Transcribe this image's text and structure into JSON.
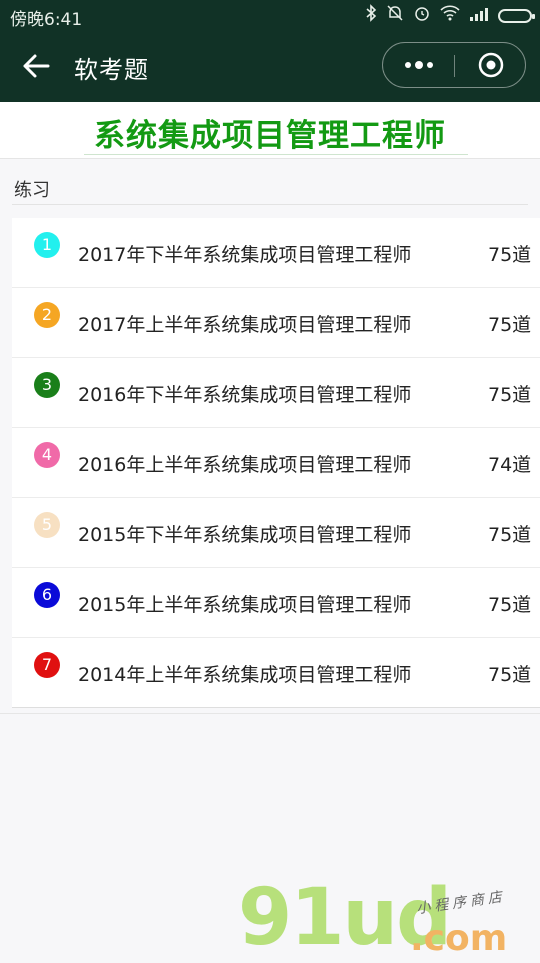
{
  "status_bar": {
    "time": "傍晚6:41",
    "icons": [
      "bluetooth-icon",
      "mute-icon",
      "alarm-icon",
      "wifi-icon",
      "signal-icon",
      "battery-icon"
    ]
  },
  "nav": {
    "title": "软考题",
    "back_icon": "arrow-left-icon",
    "more_icon": "more-dots-icon",
    "close_icon": "miniprogram-close-icon"
  },
  "banner": {
    "title": "系统集成项目管理工程师",
    "color": "#139a13"
  },
  "section": {
    "label": "练习"
  },
  "exams": [
    {
      "index": "1",
      "title": "2017年下半年系统集成项目管理工程师",
      "count": "75道",
      "color": "#22f0ee"
    },
    {
      "index": "2",
      "title": "2017年上半年系统集成项目管理工程师",
      "count": "75道",
      "color": "#f5a623"
    },
    {
      "index": "3",
      "title": "2016年下半年系统集成项目管理工程师",
      "count": "75道",
      "color": "#1a7f1a"
    },
    {
      "index": "4",
      "title": "2016年上半年系统集成项目管理工程师",
      "count": "74道",
      "color": "#f06aa8"
    },
    {
      "index": "5",
      "title": "2015年下半年系统集成项目管理工程师",
      "count": "75道",
      "color": "#f7e0c2"
    },
    {
      "index": "6",
      "title": "2015年上半年系统集成项目管理工程师",
      "count": "75道",
      "color": "#0a0ad8"
    },
    {
      "index": "7",
      "title": "2014年上半年系统集成项目管理工程师",
      "count": "75道",
      "color": "#e01010"
    }
  ],
  "watermark": {
    "main": "91ud",
    "suffix": ".com",
    "sub": "小程序商店"
  }
}
